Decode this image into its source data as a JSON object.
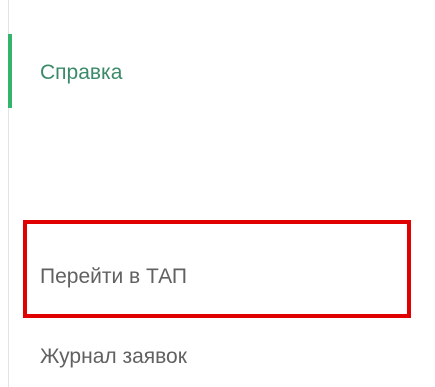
{
  "menu": {
    "items": [
      {
        "label": "Справка",
        "active": true
      },
      {
        "label": "Перейти в ТАП",
        "active": false
      },
      {
        "label": "Журнал заявок",
        "active": false
      }
    ]
  },
  "colors": {
    "active_indicator": "#34b36a",
    "active_text": "#3b8a68",
    "text": "#616161",
    "highlight": "#e00000"
  }
}
